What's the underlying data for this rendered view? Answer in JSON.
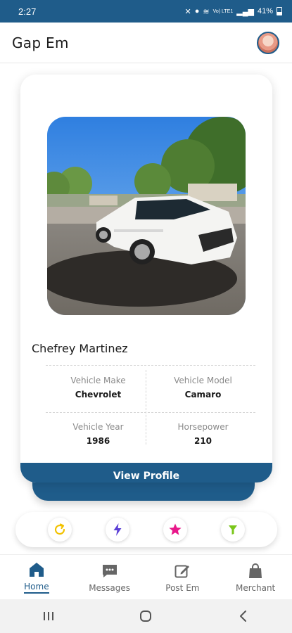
{
  "status_bar": {
    "time": "2:27",
    "battery": "41%",
    "network_label": "Vo) LTE1"
  },
  "app": {
    "title": "Gap Em"
  },
  "card": {
    "owner_name": "Chefrey Martinez",
    "specs": [
      {
        "label": "Vehicle Make",
        "value": "Chevrolet"
      },
      {
        "label": "Vehicle Model",
        "value": "Camaro"
      },
      {
        "label": "Vehicle Year",
        "value": "1986"
      },
      {
        "label": "Horsepower",
        "value": "210"
      }
    ],
    "view_profile_label": "View Profile"
  },
  "actions": [
    {
      "icon": "refresh-icon",
      "color": "#f2c200"
    },
    {
      "icon": "lightning-icon",
      "color": "#5b3fd6"
    },
    {
      "icon": "star-icon",
      "color": "#e8178a"
    },
    {
      "icon": "filter-icon",
      "color": "#7ac61a"
    }
  ],
  "bottom_nav": [
    {
      "label": "Home",
      "icon": "home-icon",
      "active": true
    },
    {
      "label": "Messages",
      "icon": "messages-icon",
      "active": false
    },
    {
      "label": "Post Em",
      "icon": "edit-icon",
      "active": false
    },
    {
      "label": "Merchant",
      "icon": "shopping-bag-icon",
      "active": false
    }
  ],
  "theme": {
    "primary": "#1f5c8a"
  }
}
